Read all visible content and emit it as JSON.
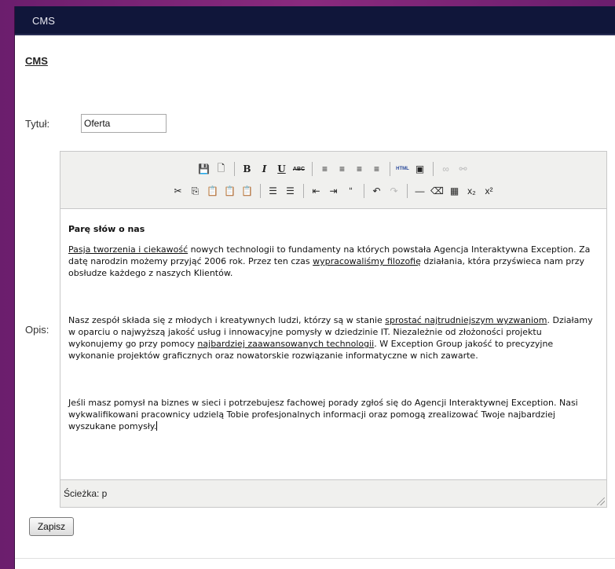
{
  "window": {
    "title": "CMS"
  },
  "page": {
    "heading": "CMS"
  },
  "form": {
    "title_label": "Tytuł:",
    "title_value": "Oferta",
    "desc_label": "Opis:",
    "submit_label": "Zapisz"
  },
  "toolbar": {
    "row1": [
      {
        "name": "save-icon",
        "glyph": "💾"
      },
      {
        "name": "new-document-icon",
        "glyph": "🗋"
      },
      {
        "sep": true
      },
      {
        "name": "bold-icon",
        "glyph": "B"
      },
      {
        "name": "italic-icon",
        "glyph": "I"
      },
      {
        "name": "underline-icon",
        "glyph": "U"
      },
      {
        "name": "strikethrough-icon",
        "glyph": "ABC"
      },
      {
        "sep": true
      },
      {
        "name": "align-left-icon",
        "glyph": "≡"
      },
      {
        "name": "align-center-icon",
        "glyph": "≡"
      },
      {
        "name": "align-right-icon",
        "glyph": "≡"
      },
      {
        "name": "align-justify-icon",
        "glyph": "≡"
      },
      {
        "sep": true
      },
      {
        "name": "html-source-icon",
        "glyph": "HTML"
      },
      {
        "name": "insert-image-icon",
        "glyph": "▣"
      },
      {
        "sep": true
      },
      {
        "name": "link-icon",
        "glyph": "∞",
        "disabled": true
      },
      {
        "name": "unlink-icon",
        "glyph": "⚯",
        "disabled": true
      }
    ],
    "row2": [
      {
        "name": "cut-icon",
        "glyph": "✂"
      },
      {
        "name": "copy-icon",
        "glyph": "⎘"
      },
      {
        "name": "paste-icon",
        "glyph": "📋"
      },
      {
        "name": "paste-text-icon",
        "glyph": "📋"
      },
      {
        "name": "paste-word-icon",
        "glyph": "📋"
      },
      {
        "sep": true
      },
      {
        "name": "bullet-list-icon",
        "glyph": "☰"
      },
      {
        "name": "numbered-list-icon",
        "glyph": "☰"
      },
      {
        "sep": true
      },
      {
        "name": "outdent-icon",
        "glyph": "⇤"
      },
      {
        "name": "indent-icon",
        "glyph": "⇥"
      },
      {
        "name": "blockquote-icon",
        "glyph": "“"
      },
      {
        "sep": true
      },
      {
        "name": "undo-icon",
        "glyph": "↶"
      },
      {
        "name": "redo-icon",
        "glyph": "↷",
        "disabled": true
      },
      {
        "sep": true
      },
      {
        "name": "horizontal-rule-icon",
        "glyph": "—"
      },
      {
        "name": "remove-format-icon",
        "glyph": "⌫"
      },
      {
        "name": "visual-aid-icon",
        "glyph": "▦"
      },
      {
        "name": "subscript-icon",
        "glyph": "x₂"
      },
      {
        "name": "superscript-icon",
        "glyph": "x²"
      }
    ]
  },
  "content": {
    "heading": "Parę słów o nas",
    "paragraphs": [
      [
        {
          "t": "Pasja tworzenia i ciekawość",
          "u": true
        },
        {
          "t": " nowych technologii to fundamenty na których powstała Agencja Interaktywna Exception. Za datę narodzin możemy przyjąć 2006 rok. Przez ten czas "
        },
        {
          "t": "wypracowaliśmy filozofię",
          "u": true
        },
        {
          "t": " działania, która przyświeca nam przy obsłudze każdego z naszych Klientów."
        }
      ],
      [
        {
          "t": "Nasz zespół składa się z młodych i kreatywnych ludzi, którzy są w stanie "
        },
        {
          "t": "sprostać najtrudniejszym wyzwaniom",
          "u": true
        },
        {
          "t": ". Działamy w oparciu o najwyższą jakość usług i innowacyjne pomysły w dziedzinie IT. Niezależnie od złożoności projektu wykonujemy go przy pomocy "
        },
        {
          "t": "najbardziej zaawansowanych technologii",
          "u": true
        },
        {
          "t": ". W Exception Group jakość to precyzyjne wykonanie projektów graficznych oraz nowatorskie rozwiązanie informatyczne w nich zawarte."
        }
      ],
      [
        {
          "t": "Jeśli masz pomysł na biznes w sieci i potrzebujesz fachowej porady zgłoś się do Agencji Interaktywnej Exception. Nasi wykwalifikowani pracownicy udzielą Tobie profesjonalnych informacji oraz pomogą zrealizować Twoje najbardziej wyszukane pomysły."
        }
      ]
    ]
  },
  "statusbar": {
    "path": "Ścieżka: p"
  }
}
